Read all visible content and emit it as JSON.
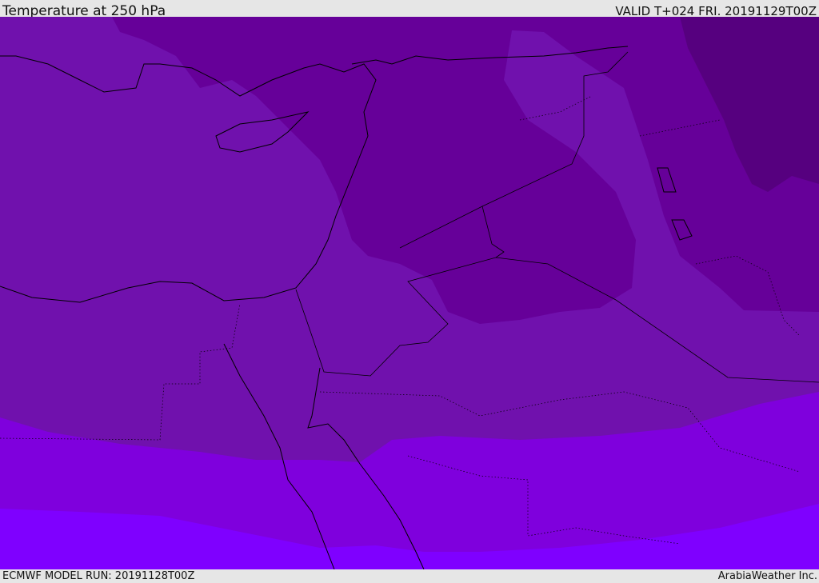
{
  "header": {
    "title": "Temperature at 250 hPa",
    "valid": "VALID T+024 FRI. 20191129T00Z"
  },
  "footer": {
    "model_run": "ECMWF MODEL RUN: 20191128T00Z",
    "brand": "ArabiaWeather Inc."
  },
  "colors": {
    "darkest": "#56007f",
    "dark": "#660099",
    "medium": "#7011ad",
    "light": "#7f00dd",
    "lightest": "#7f00ff"
  }
}
